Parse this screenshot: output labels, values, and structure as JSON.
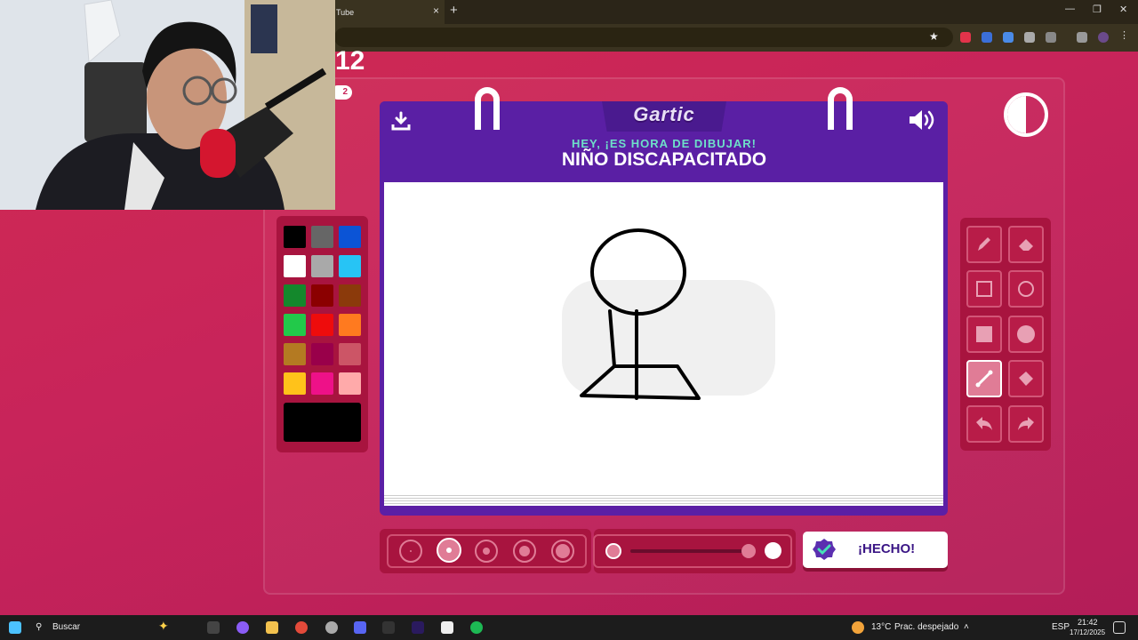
{
  "browser": {
    "tab_title": "Tube",
    "close_glyph": "×",
    "new_tab_glyph": "+",
    "window": {
      "minimize": "—",
      "restore": "❐",
      "close": "✕"
    },
    "bookmark_glyph": "★"
  },
  "game": {
    "timer": "12",
    "timer_sub": "2",
    "logo": "Gartic",
    "subtitle": "HEY, ¡ES HORA DE DIBUJAR!",
    "prompt": "NIÑO DISCAPACITADO",
    "done_label": "¡HECHO!",
    "palette": {
      "colors": [
        "#000000",
        "#666666",
        "#0b54d6",
        "#ffffff",
        "#a9a9a9",
        "#27c4f5",
        "#14882c",
        "#8b0000",
        "#8b3a0b",
        "#22c94a",
        "#ee0c0c",
        "#ff7a1f",
        "#b47a22",
        "#99004a",
        "#cc5566",
        "#ffc21a",
        "#ee1188",
        "#ffaaaa"
      ],
      "selected_color": "#000000"
    },
    "tools": [
      "pencil-icon",
      "eraser-icon",
      "rect-outline-icon",
      "ellipse-outline-icon",
      "rect-filled-icon",
      "ellipse-filled-icon",
      "line-icon",
      "fill-bucket-icon",
      "undo-icon",
      "redo-icon"
    ],
    "active_tool": "line-icon",
    "brush_sizes": [
      "1",
      "2",
      "3",
      "4",
      "5"
    ],
    "selected_size": 2,
    "opacity_level": 1.0
  },
  "taskbar": {
    "search_placeholder": "Buscar",
    "weather_temp": "13°C",
    "weather_desc": "Prac. despejado",
    "lang": "ESP",
    "time": "21:42",
    "date": "17/12/2025"
  }
}
